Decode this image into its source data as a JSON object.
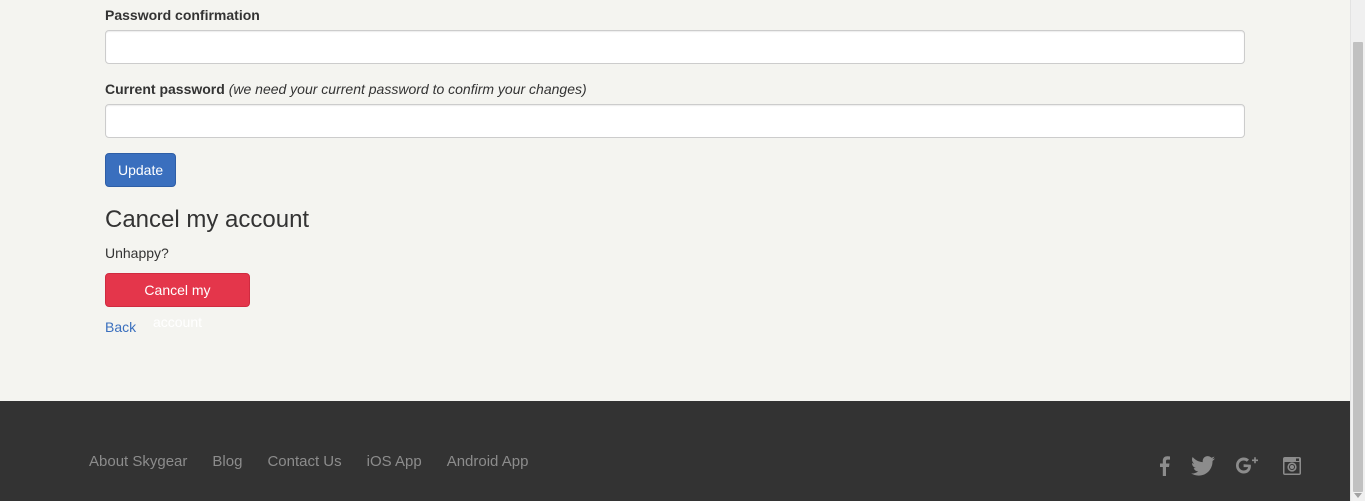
{
  "form": {
    "password_confirmation_label": "Password confirmation",
    "password_confirmation_value": "",
    "current_password_label": "Current password",
    "current_password_hint": "(we need your current password to confirm your changes)",
    "current_password_value": "",
    "update_label": "Update"
  },
  "cancel_section": {
    "heading": "Cancel my account",
    "text": "Unhappy?",
    "button_label": "Cancel my account"
  },
  "back_link": "Back",
  "footer": {
    "links": [
      "About Skygear",
      "Blog",
      "Contact Us",
      "iOS App",
      "Android App"
    ],
    "social_icons": [
      "facebook-icon",
      "twitter-icon",
      "google-plus-icon",
      "instagram-icon"
    ]
  },
  "colors": {
    "page_background": "#f4f4f0",
    "primary": "#3a6fbe",
    "danger": "#e4364b",
    "footer_background": "#333333",
    "footer_link": "#8c8c8c"
  }
}
